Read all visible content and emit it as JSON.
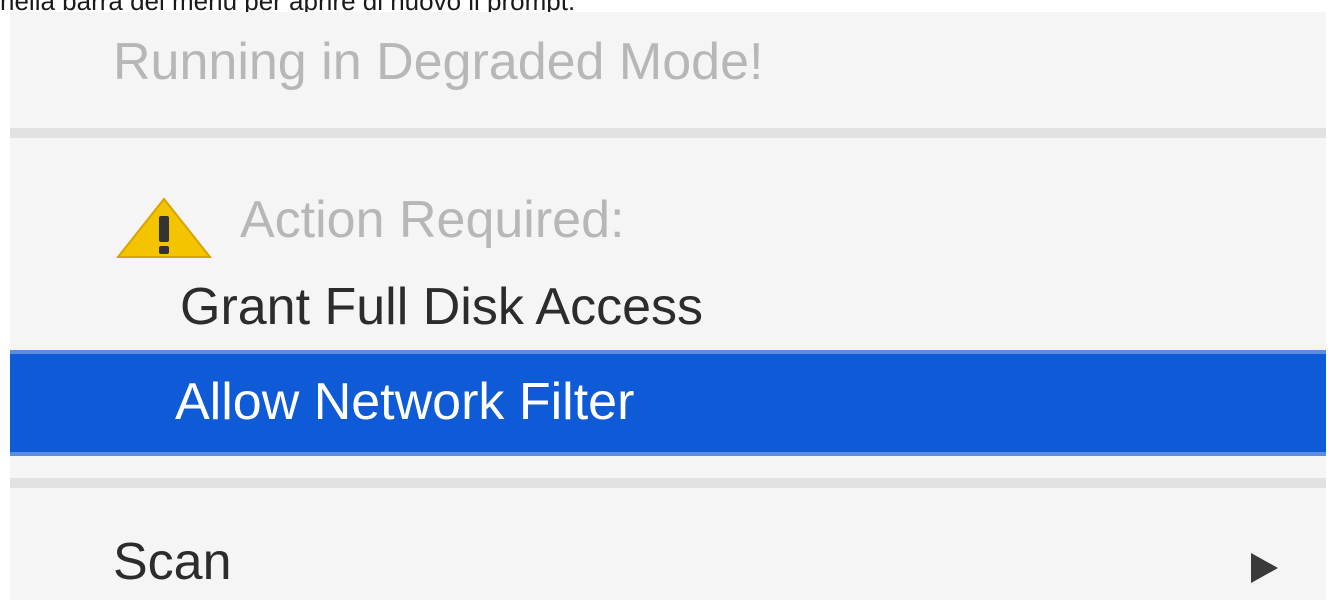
{
  "background_caption": "nella barra dei menu per aprire di nuovo il prompt.",
  "menu": {
    "status_label": "Running in Degraded Mode!",
    "action_required_label": "Action Required:",
    "action_icon": "warning-icon",
    "items": [
      {
        "label": "Grant Full Disk Access",
        "state": "enabled"
      },
      {
        "label": "Allow Network Filter",
        "state": "highlighted"
      },
      {
        "label": "Scan",
        "state": "enabled",
        "has_submenu": true
      }
    ]
  },
  "colors": {
    "menu_background": "#f5f5f5",
    "highlight": "#0f5ad6",
    "disabled_text": "#b7b7b7",
    "enabled_text": "#2c2c2c",
    "warning": "#f5c400"
  }
}
